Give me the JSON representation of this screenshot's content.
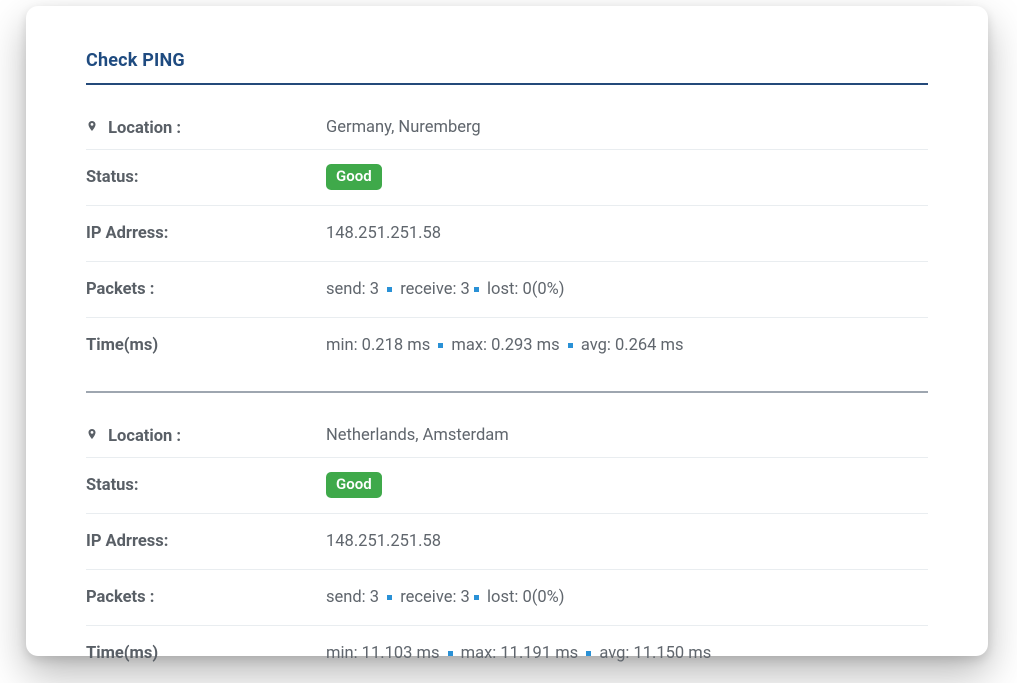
{
  "title": "Check PING",
  "labels": {
    "location": "Location :",
    "status": "Status:",
    "ip": "IP Adrress:",
    "packets": "Packets :",
    "time": "Time(ms)"
  },
  "colors": {
    "title": "#1f4b80",
    "badge_bg": "#3fa94a",
    "separator": "#2a91d6"
  },
  "results": [
    {
      "location": "Germany, Nuremberg",
      "status": "Good",
      "ip": "148.251.251.58",
      "packets": {
        "send": "send: 3",
        "receive": "receive: 3",
        "lost": "lost: 0(0%)"
      },
      "time": {
        "min": "min: 0.218 ms",
        "max": "max: 0.293 ms",
        "avg": "avg: 0.264 ms"
      }
    },
    {
      "location": "Netherlands, Amsterdam",
      "status": "Good",
      "ip": "148.251.251.58",
      "packets": {
        "send": "send: 3",
        "receive": "receive: 3",
        "lost": "lost: 0(0%)"
      },
      "time": {
        "min": "min: 11.103 ms",
        "max": "max: 11.191 ms",
        "avg": "avg: 11.150 ms"
      }
    }
  ]
}
